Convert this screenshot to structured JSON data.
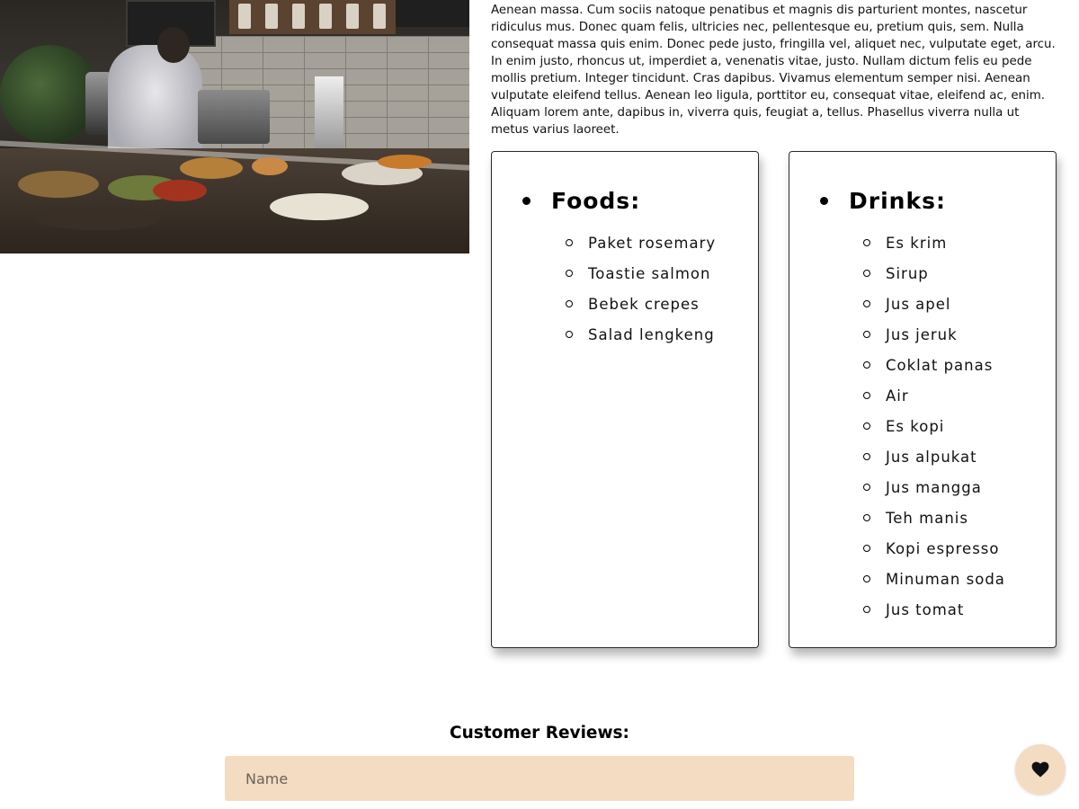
{
  "intro_paragraph": "Aenean massa. Cum sociis natoque penatibus et magnis dis parturient montes, nascetur ridiculus mus. Donec quam felis, ultricies nec, pellentesque eu, pretium quis, sem. Nulla consequat massa quis enim. Donec pede justo, fringilla vel, aliquet nec, vulputate eget, arcu. In enim justo, rhoncus ut, imperdiet a, venenatis vitae, justo. Nullam dictum felis eu pede mollis pretium. Integer tincidunt. Cras dapibus. Vivamus elementum semper nisi. Aenean vulputate eleifend tellus. Aenean leo ligula, porttitor eu, consequat vitae, eleifend ac, enim. Aliquam lorem ante, dapibus in, viverra quis, feugiat a, tellus. Phasellus viverra nulla ut metus varius laoreet.",
  "menu": {
    "foods": {
      "title": "Foods:",
      "items": [
        "Paket rosemary",
        "Toastie salmon",
        "Bebek crepes",
        "Salad lengkeng"
      ]
    },
    "drinks": {
      "title": "Drinks:",
      "items": [
        "Es krim",
        "Sirup",
        "Jus apel",
        "Jus jeruk",
        "Coklat panas",
        "Air",
        "Es kopi",
        "Jus alpukat",
        "Jus mangga",
        "Teh manis",
        "Kopi espresso",
        "Minuman soda",
        "Jus tomat"
      ]
    }
  },
  "reviews": {
    "title": "Customer Reviews:",
    "name_placeholder": "Name"
  },
  "fab_icon": "heart-icon",
  "colors": {
    "accent": "#f3dcc2",
    "text": "#111111"
  }
}
